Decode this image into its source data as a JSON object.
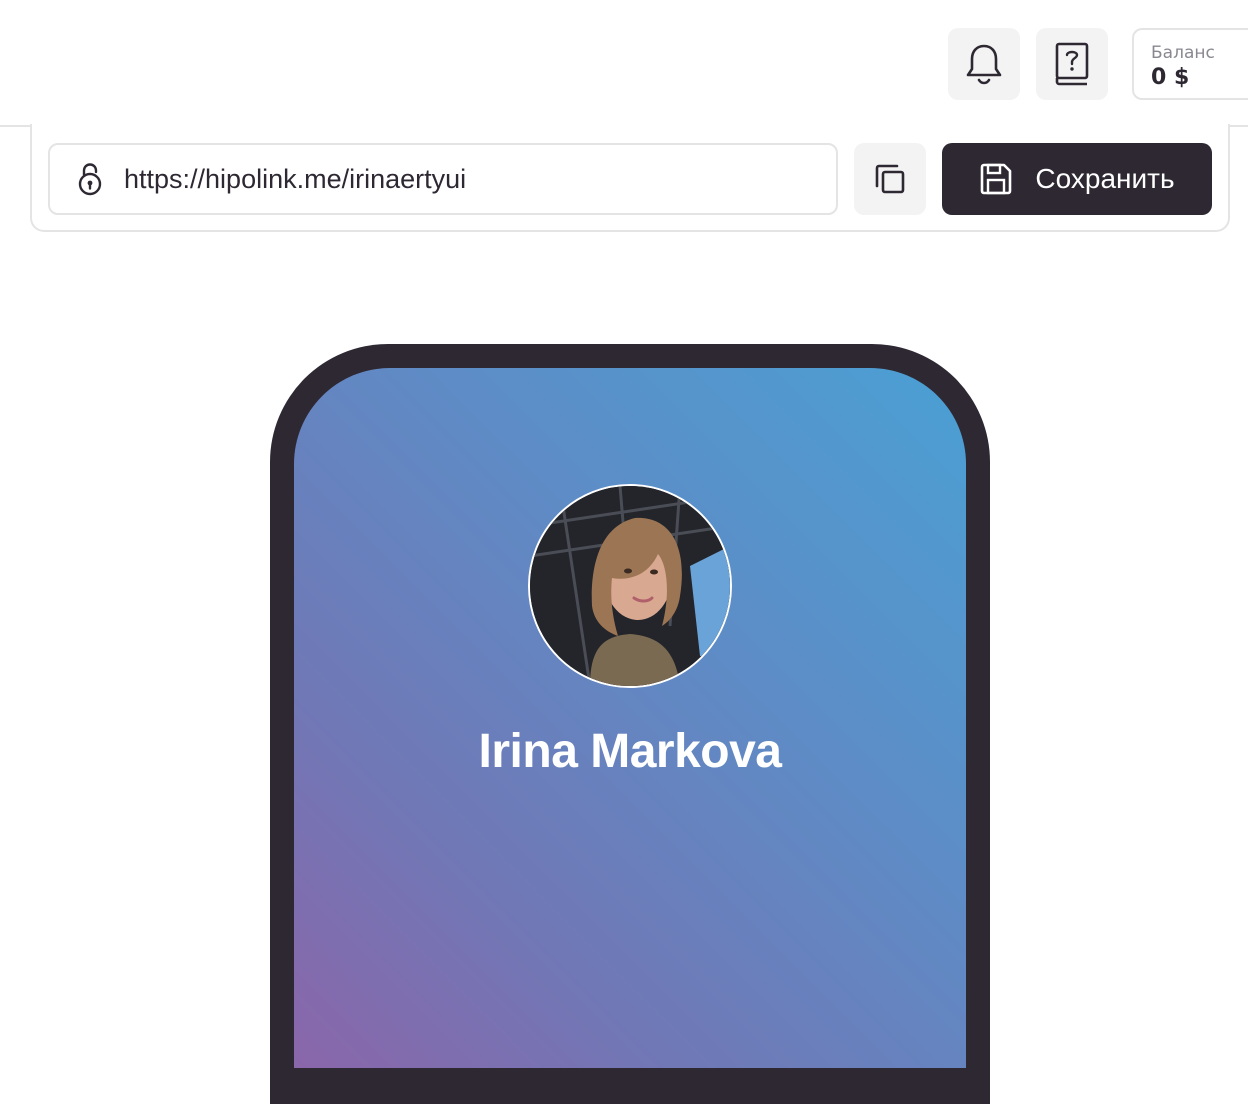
{
  "header": {
    "notifications_icon": "bell-icon",
    "help_icon": "help-book-icon",
    "balance": {
      "label": "Баланс",
      "value": "0 $"
    }
  },
  "link_panel": {
    "lock_icon": "lock-icon",
    "url": "https://hipolink.me/irinaertyui",
    "copy_icon": "copy-icon",
    "save_icon": "floppy-disk-icon",
    "save_label": "Сохранить"
  },
  "preview": {
    "profile_name": "Irina Markova",
    "gradient_colors": [
      "#4aa0d4",
      "#5e8cc6",
      "#7078b6",
      "#8a66aa"
    ],
    "frame_color": "#2e2833"
  }
}
